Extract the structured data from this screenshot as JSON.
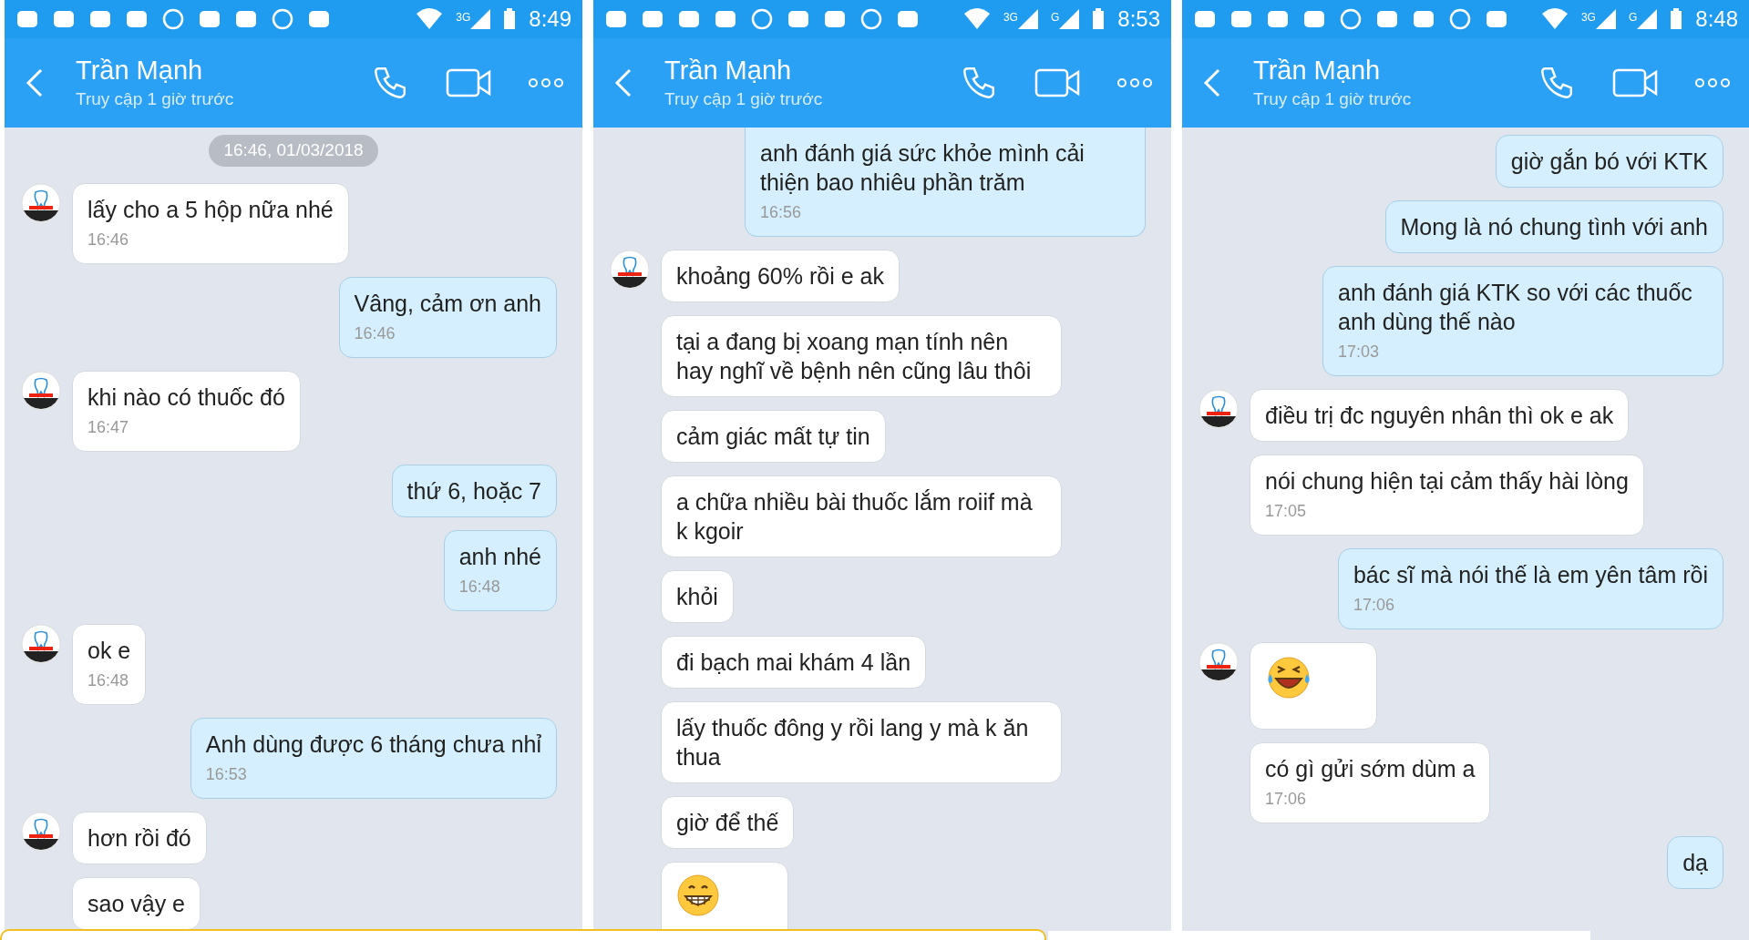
{
  "panels": [
    {
      "status": {
        "net": [
          "3G"
        ],
        "time": "8:49"
      },
      "header": {
        "name": "Trần Mạnh",
        "status": "Truy cập 1 giờ trước"
      },
      "messages": [
        {
          "kind": "date",
          "text": "16:46, 01/03/2018"
        },
        {
          "kind": "in",
          "avatar": true,
          "text": "lấy cho a 5 hộp nữa nhé",
          "time": "16:46"
        },
        {
          "kind": "out",
          "text": "Vâng, cảm ơn anh",
          "time": "16:46"
        },
        {
          "kind": "in",
          "avatar": true,
          "text": "khi nào có thuốc đó",
          "time": "16:47"
        },
        {
          "kind": "out",
          "text": "thứ 6, hoặc 7"
        },
        {
          "kind": "out",
          "text": "anh nhé",
          "time": "16:48"
        },
        {
          "kind": "in",
          "avatar": true,
          "text": "ok e",
          "time": "16:48"
        },
        {
          "kind": "out",
          "text": "Anh dùng được 6 tháng chưa nhỉ",
          "time": "16:53"
        },
        {
          "kind": "in",
          "avatar": true,
          "text": "hơn rồi đó"
        },
        {
          "kind": "in",
          "text": "sao vậy e"
        }
      ]
    },
    {
      "status": {
        "net": [
          "3G",
          "G"
        ],
        "time": "8:53"
      },
      "header": {
        "name": "Trần Mạnh",
        "status": "Truy cập 1 giờ trước"
      },
      "messages": [
        {
          "kind": "out",
          "cut_top": true,
          "text": "anh đánh giá sức khỏe mình cải thiện bao nhiêu phần trăm",
          "time": "16:56"
        },
        {
          "kind": "in",
          "avatar": true,
          "text": "khoảng 60% rồi e ak"
        },
        {
          "kind": "in",
          "text": "tại a đang bị xoang mạn tính nên hay nghĩ về bệnh nên cũng lâu thôi"
        },
        {
          "kind": "in",
          "text": "cảm giác mất tự tin"
        },
        {
          "kind": "in",
          "text": "a chữa nhiều bài thuốc lắm roiif mà k kgoir"
        },
        {
          "kind": "in",
          "text": "khỏi"
        },
        {
          "kind": "in",
          "text": "đi bạch mai khám 4 lần"
        },
        {
          "kind": "in",
          "text": "lấy thuốc đông y rồi lang y mà k ăn thua"
        },
        {
          "kind": "in",
          "text": "giờ để thế"
        },
        {
          "kind": "emoji"
        }
      ]
    },
    {
      "status": {
        "net": [
          "3G",
          "G"
        ],
        "time": "8:48"
      },
      "header": {
        "name": "Trần Mạnh",
        "status": "Truy cập 1 giờ trước"
      },
      "messages": [
        {
          "kind": "out",
          "text": "giờ gắn bó với KTK"
        },
        {
          "kind": "out",
          "text": "Mong là nó chung tình với anh"
        },
        {
          "kind": "out",
          "text": "anh đánh giá KTK so với các thuốc anh dùng thế nào",
          "time": "17:03"
        },
        {
          "kind": "in",
          "avatar": true,
          "text": "điều trị đc nguyên nhân thì ok e ak"
        },
        {
          "kind": "in",
          "text": "nói chung hiện tại cảm thấy hài lòng",
          "time": "17:05"
        },
        {
          "kind": "out",
          "text": "bác sĩ mà nói thế là em yên tâm rồi",
          "time": "17:06"
        },
        {
          "kind": "emoji",
          "avatar": true
        },
        {
          "kind": "in",
          "text": "có gì gửi sớm dùm a",
          "time": "17:06"
        },
        {
          "kind": "out",
          "text": "dạ"
        }
      ]
    }
  ]
}
